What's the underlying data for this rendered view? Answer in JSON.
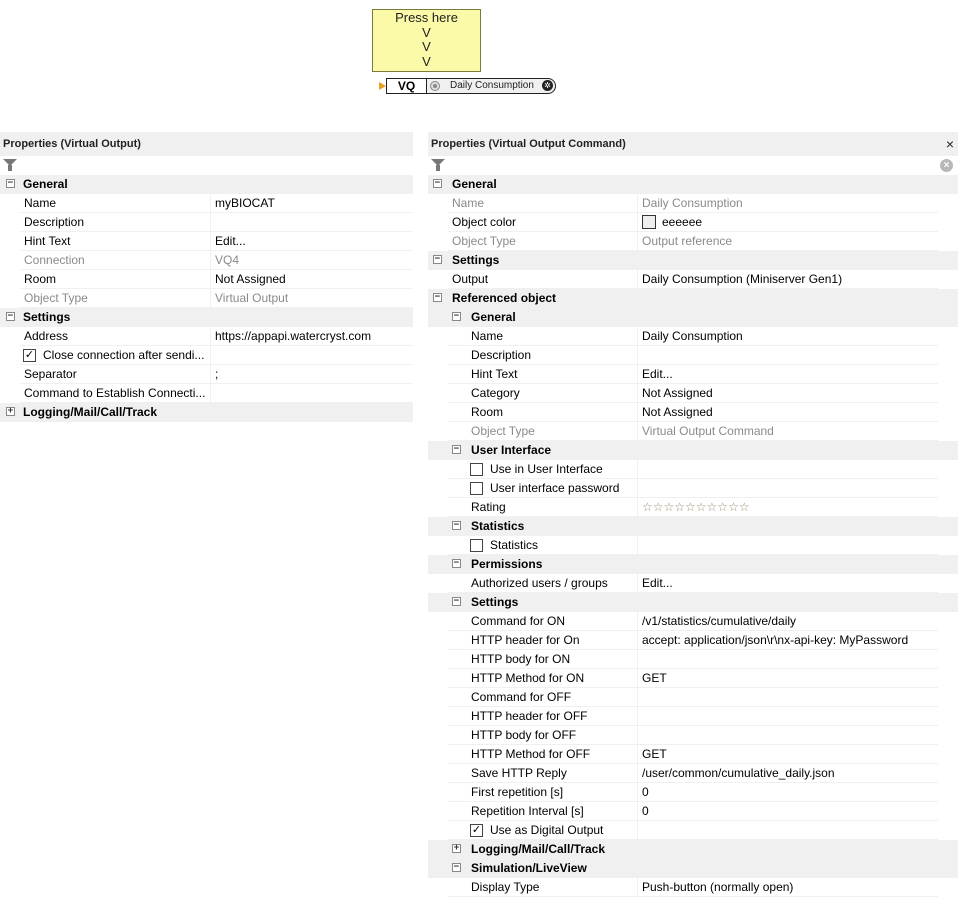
{
  "canvas": {
    "note_lines": [
      "Press here",
      "V",
      "V",
      "V"
    ],
    "block": {
      "tag": "VQ",
      "label": "Daily Consumption"
    }
  },
  "left_panel": {
    "title": "Properties (Virtual Output)",
    "rows": [
      {
        "type": "cat",
        "label": "General",
        "expanded": true
      },
      {
        "type": "prop",
        "key": "Name",
        "value": "myBIOCAT"
      },
      {
        "type": "prop",
        "key": "Description",
        "value": ""
      },
      {
        "type": "prop",
        "key": "Hint Text",
        "value": "Edit..."
      },
      {
        "type": "prop",
        "key": "Connection",
        "value": "VQ4",
        "readonly": true
      },
      {
        "type": "prop",
        "key": "Room",
        "value": "Not Assigned"
      },
      {
        "type": "prop",
        "key": "Object Type",
        "value": "Virtual Output",
        "readonly": true
      },
      {
        "type": "cat",
        "label": "Settings",
        "expanded": true
      },
      {
        "type": "prop",
        "key": "Address",
        "value": "https://appapi.watercryst.com"
      },
      {
        "type": "check",
        "key": "Close connection after sendi...",
        "checked": true
      },
      {
        "type": "prop",
        "key": "Separator",
        "value": ";"
      },
      {
        "type": "prop",
        "key": "Command to Establish Connecti...",
        "value": ""
      },
      {
        "type": "cat",
        "label": "Logging/Mail/Call/Track",
        "expanded": false
      }
    ]
  },
  "right_panel": {
    "title": "Properties (Virtual Output Command)",
    "close_glyph": "×",
    "rows": [
      {
        "type": "cat",
        "label": "General",
        "expanded": true,
        "level": 0
      },
      {
        "type": "prop",
        "key": "Name",
        "value": "Daily Consumption",
        "readonly": true,
        "level": 0
      },
      {
        "type": "prop",
        "key": "Object color",
        "value": "eeeeee",
        "swatch": "#eeeeee",
        "level": 0
      },
      {
        "type": "prop",
        "key": "Object Type",
        "value": "Output reference",
        "readonly": true,
        "level": 0
      },
      {
        "type": "cat",
        "label": "Settings",
        "expanded": true,
        "level": 0
      },
      {
        "type": "prop",
        "key": "Output",
        "value": "Daily Consumption (Miniserver Gen1)",
        "level": 0
      },
      {
        "type": "cat",
        "label": "Referenced object",
        "expanded": true,
        "level": 0
      },
      {
        "type": "cat",
        "label": "General",
        "expanded": true,
        "level": 1
      },
      {
        "type": "prop",
        "key": "Name",
        "value": "Daily Consumption",
        "level": 1
      },
      {
        "type": "prop",
        "key": "Description",
        "value": "",
        "level": 1
      },
      {
        "type": "prop",
        "key": "Hint Text",
        "value": "Edit...",
        "level": 1
      },
      {
        "type": "prop",
        "key": "Category",
        "value": "Not Assigned",
        "level": 1
      },
      {
        "type": "prop",
        "key": "Room",
        "value": "Not Assigned",
        "level": 1
      },
      {
        "type": "prop",
        "key": "Object Type",
        "value": "Virtual Output Command",
        "readonly": true,
        "level": 1
      },
      {
        "type": "cat",
        "label": "User Interface",
        "expanded": true,
        "level": 1
      },
      {
        "type": "check",
        "key": "Use in User Interface",
        "checked": false,
        "level": 1
      },
      {
        "type": "check",
        "key": "User interface password",
        "checked": false,
        "level": 1
      },
      {
        "type": "prop",
        "key": "Rating",
        "value": "☆☆☆☆☆☆☆☆☆☆",
        "stars": true,
        "level": 1
      },
      {
        "type": "cat",
        "label": "Statistics",
        "expanded": true,
        "level": 1
      },
      {
        "type": "check",
        "key": "Statistics",
        "checked": false,
        "level": 1
      },
      {
        "type": "cat",
        "label": "Permissions",
        "expanded": true,
        "level": 1
      },
      {
        "type": "prop",
        "key": "Authorized users / groups",
        "value": "Edit...",
        "level": 1
      },
      {
        "type": "cat",
        "label": "Settings",
        "expanded": true,
        "level": 1
      },
      {
        "type": "prop",
        "key": "Command for ON",
        "value": "/v1/statistics/cumulative/daily",
        "level": 1
      },
      {
        "type": "prop",
        "key": "HTTP header for On",
        "value": "accept: application/json\\r\\nx-api-key: MyPassword",
        "level": 1
      },
      {
        "type": "prop",
        "key": "HTTP body for ON",
        "value": "",
        "level": 1
      },
      {
        "type": "prop",
        "key": "HTTP Method for ON",
        "value": "GET",
        "level": 1
      },
      {
        "type": "prop",
        "key": "Command for OFF",
        "value": "",
        "level": 1
      },
      {
        "type": "prop",
        "key": "HTTP header for OFF",
        "value": "",
        "level": 1
      },
      {
        "type": "prop",
        "key": "HTTP body for OFF",
        "value": "",
        "level": 1
      },
      {
        "type": "prop",
        "key": "HTTP Method for OFF",
        "value": "GET",
        "level": 1
      },
      {
        "type": "prop",
        "key": "Save HTTP Reply",
        "value": "/user/common/cumulative_daily.json",
        "level": 1
      },
      {
        "type": "prop",
        "key": "First repetition [s]",
        "value": "0",
        "level": 1
      },
      {
        "type": "prop",
        "key": "Repetition Interval [s]",
        "value": "0",
        "level": 1
      },
      {
        "type": "check",
        "key": "Use as Digital Output",
        "checked": true,
        "level": 1
      },
      {
        "type": "cat",
        "label": "Logging/Mail/Call/Track",
        "expanded": false,
        "level": 1
      },
      {
        "type": "cat",
        "label": "Simulation/LiveView",
        "expanded": true,
        "level": 1
      },
      {
        "type": "prop",
        "key": "Display Type",
        "value": "Push-button (normally open)",
        "level": 1
      }
    ]
  }
}
